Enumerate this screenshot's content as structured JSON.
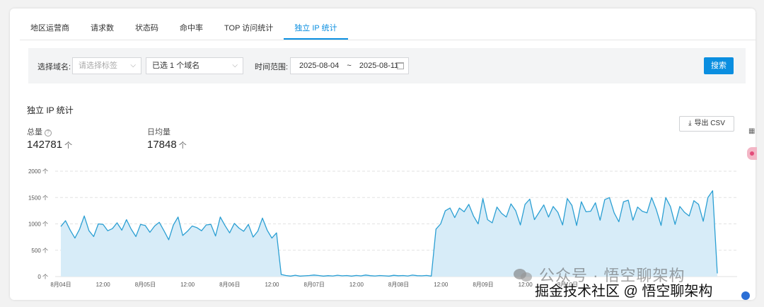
{
  "tabs": [
    {
      "label": "地区运营商",
      "active": false
    },
    {
      "label": "请求数",
      "active": false
    },
    {
      "label": "状态码",
      "active": false
    },
    {
      "label": "命中率",
      "active": false
    },
    {
      "label": "TOP 访问统计",
      "active": false
    },
    {
      "label": "独立 IP 统计",
      "active": true
    }
  ],
  "filter": {
    "domain_label": "选择域名:",
    "tag_placeholder": "请选择标签",
    "domain_selected": "已选 1 个域名",
    "time_label": "时间范围:",
    "date_start": "2025-08-04",
    "date_sep": "~",
    "date_end": "2025-08-11",
    "search_label": "搜索"
  },
  "section_title": "独立 IP 统计",
  "metrics": {
    "total_label": "总量",
    "total_value": "142781",
    "avg_label": "日均量",
    "avg_value": "17848",
    "arrow": "个"
  },
  "export_label": "导出 CSV",
  "colors": {
    "accent": "#0a8ee0",
    "line": "#2b9fd3",
    "fill": "#d7ecf8"
  },
  "chart_data": {
    "type": "area",
    "ylim": [
      0,
      2000
    ],
    "y_ticks": [
      "2000 个",
      "1500 个",
      "1000 个",
      "500 个",
      "0 个"
    ],
    "y_tick_values": [
      2000,
      1500,
      1000,
      500,
      0
    ],
    "x_tick_labels": [
      "8月04日",
      "12:00",
      "8月05日",
      "12:00",
      "8月06日",
      "12:00",
      "8月07日",
      "12:00",
      "8月08日",
      "12:00",
      "8月09日",
      "12:00",
      "8月10日"
    ],
    "grid": true,
    "series": [
      {
        "values": [
          950,
          1060,
          880,
          730,
          900,
          1150,
          870,
          760,
          1000,
          990,
          870,
          910,
          1020,
          880,
          1080,
          900,
          760,
          990,
          970,
          840,
          960,
          1030,
          870,
          700,
          980,
          1130,
          780,
          860,
          960,
          930,
          870,
          980,
          990,
          770,
          1130,
          970,
          830,
          1010,
          920,
          860,
          990,
          750,
          860,
          1110,
          880,
          730,
          830,
          40,
          20,
          10,
          25,
          10,
          15,
          20,
          30,
          20,
          10,
          18,
          12,
          25,
          15,
          20,
          10,
          22,
          14,
          30,
          18,
          12,
          20,
          15,
          10,
          24,
          16,
          20,
          12,
          28,
          18,
          15,
          22,
          10,
          900,
          1000,
          1250,
          1300,
          1120,
          1300,
          1230,
          1370,
          1150,
          1000,
          1480,
          1080,
          1020,
          1320,
          1200,
          1130,
          1380,
          1250,
          980,
          1370,
          1470,
          1080,
          1220,
          1360,
          1130,
          1330,
          1220,
          980,
          1480,
          1350,
          970,
          1420,
          1230,
          1240,
          1400,
          1070,
          1460,
          1500,
          1210,
          1040,
          1420,
          1450,
          1070,
          1320,
          1240,
          1210,
          1500,
          1270,
          970,
          1500,
          1330,
          990,
          1330,
          1220,
          1150,
          1440,
          1370,
          1050,
          1500,
          1630,
          60
        ]
      }
    ]
  },
  "watermark": {
    "line1": "公众号 · 悟空聊架构",
    "line2": "掘金技术社区 @ 悟空聊架构"
  }
}
